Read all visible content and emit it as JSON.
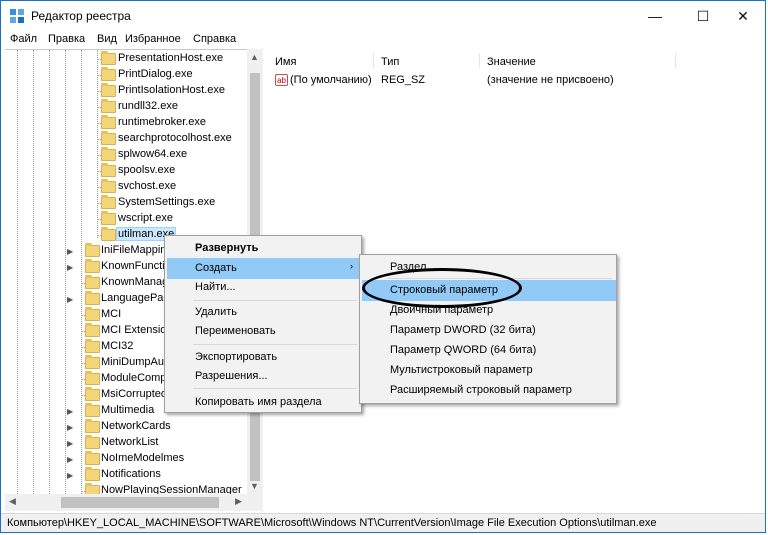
{
  "window": {
    "title": "Редактор реестра",
    "controls": {
      "minimize": "—",
      "maximize": "☐",
      "close": "✕"
    }
  },
  "menubar": [
    "Файл",
    "Правка",
    "Вид",
    "Избранное",
    "Справка"
  ],
  "tree": {
    "items": [
      {
        "label": "PresentationHost.exe"
      },
      {
        "label": "PrintDialog.exe"
      },
      {
        "label": "PrintIsolationHost.exe"
      },
      {
        "label": "rundll32.exe"
      },
      {
        "label": "runtimebroker.exe"
      },
      {
        "label": "searchprotocolhost.exe"
      },
      {
        "label": "splwow64.exe"
      },
      {
        "label": "spoolsv.exe"
      },
      {
        "label": "svchost.exe"
      },
      {
        "label": "SystemSettings.exe"
      },
      {
        "label": "wscript.exe"
      },
      {
        "label": "utilman.exe"
      },
      {
        "label": "IniFileMapping"
      },
      {
        "label": "KnownFunctio"
      },
      {
        "label": "KnownManag"
      },
      {
        "label": "LanguagePac"
      },
      {
        "label": "MCI"
      },
      {
        "label": "MCI Extension"
      },
      {
        "label": "MCI32"
      },
      {
        "label": "MiniDumpAu"
      },
      {
        "label": "ModuleComp"
      },
      {
        "label": "MsiCorrupted"
      },
      {
        "label": "Multimedia"
      },
      {
        "label": "NetworkCards"
      },
      {
        "label": "NetworkList"
      },
      {
        "label": "NoImeModelmes"
      },
      {
        "label": "Notifications"
      },
      {
        "label": "NowPlayingSessionManager"
      }
    ]
  },
  "listview": {
    "columns": [
      "Имя",
      "Тип",
      "Значение"
    ],
    "rows": [
      {
        "icon": "ab",
        "name": "(По умолчанию)",
        "type": "REG_SZ",
        "value": "(значение не присвоено)"
      }
    ]
  },
  "context_menu": {
    "items": [
      "Развернуть",
      "Создать",
      "Найти...",
      "Удалить",
      "Переименовать",
      "Экспортировать",
      "Разрешения...",
      "Копировать имя раздела"
    ],
    "submenu_arrow": "›"
  },
  "submenu": {
    "items": [
      "Раздел",
      "Строковый параметр",
      "Двоичный параметр",
      "Параметр DWORD (32 бита)",
      "Параметр QWORD (64 бита)",
      "Мультистроковый параметр",
      "Расширяемый строковый параметр"
    ]
  },
  "statusbar": {
    "path": "Компьютер\\HKEY_LOCAL_MACHINE\\SOFTWARE\\Microsoft\\Windows NT\\CurrentVersion\\Image File Execution Options\\utilman.exe"
  },
  "scroll": {
    "left_arrow": "◀",
    "right_arrow": "▶",
    "up_arrow": "▲",
    "down_arrow": "▼"
  },
  "colors": {
    "accent": "#1e6fc9",
    "highlight": "#91c9f7",
    "selection": "#cce8ff",
    "folder": "#f5d57a"
  },
  "icons": [
    "registry-app-icon",
    "folder-icon",
    "expand-arrow-icon",
    "string-value-icon"
  ]
}
